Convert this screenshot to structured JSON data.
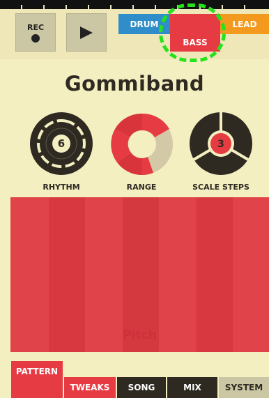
{
  "transport": {
    "rec_label": "REC"
  },
  "instruments": {
    "drum": "DRUM",
    "bass": "BASS",
    "lead": "LEAD"
  },
  "title": "Gommiband",
  "knobs": {
    "rhythm": {
      "label": "RHYTHM",
      "value": "6"
    },
    "range": {
      "label": "RANGE"
    },
    "scale_steps": {
      "label": "SCALE STEPS",
      "value": "3"
    }
  },
  "pad": {
    "label": "Pitch"
  },
  "tabs": {
    "pattern": "PATTERN",
    "tweaks": "TWEAKS",
    "song": "SONG",
    "mix": "MIX",
    "system": "SYSTEM"
  },
  "colors": {
    "background": "#f4efc1",
    "red": "#e63b42",
    "drum_blue": "#2f8ec9",
    "lead_orange": "#f39a1e",
    "dark": "#2e2a22",
    "highlight_green": "#26e21d"
  }
}
